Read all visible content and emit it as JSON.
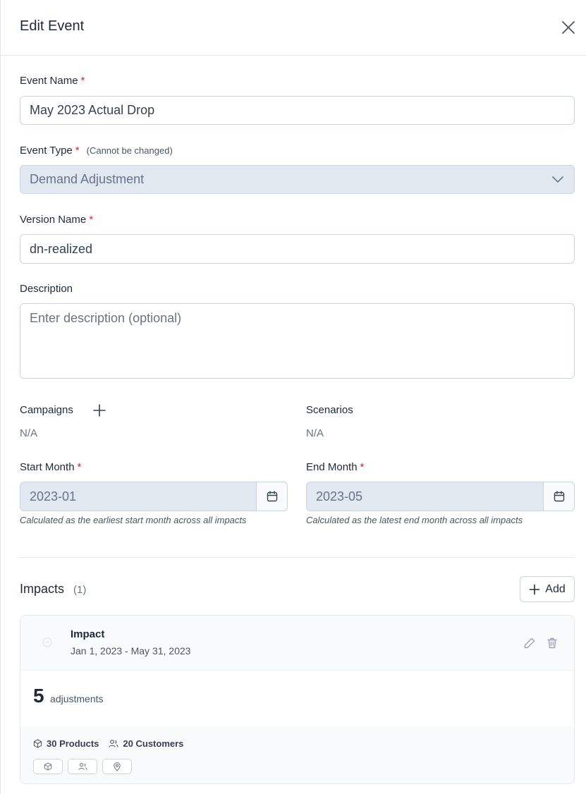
{
  "header": {
    "title": "Edit Event",
    "close_icon": "close-icon"
  },
  "form": {
    "event_name": {
      "label": "Event Name",
      "required_mark": "*",
      "value": "May 2023 Actual Drop"
    },
    "event_type": {
      "label": "Event Type",
      "required_mark": "*",
      "hint": "(Cannot be changed)",
      "value": "Demand Adjustment"
    },
    "version_name": {
      "label": "Version Name",
      "required_mark": "*",
      "value": "dn-realized"
    },
    "description": {
      "label": "Description",
      "placeholder": "Enter description (optional)"
    },
    "campaigns": {
      "label": "Campaigns",
      "value": "N/A"
    },
    "scenarios": {
      "label": "Scenarios",
      "value": "N/A"
    },
    "start_month": {
      "label": "Start Month",
      "required_mark": "*",
      "value": "2023-01",
      "caption": "Calculated as the earliest start month across all impacts"
    },
    "end_month": {
      "label": "End Month",
      "required_mark": "*",
      "value": "2023-05",
      "caption": "Calculated as the latest end month across all impacts"
    }
  },
  "impacts": {
    "title": "Impacts",
    "count": "(1)",
    "add_label": "Add",
    "items": [
      {
        "title": "Impact",
        "date_range": "Jan 1, 2023 - May 31, 2023",
        "adjustments_count": "5",
        "adjustments_label": "adjustments",
        "products": "30 Products",
        "customers": "20 Customers"
      }
    ]
  },
  "colors": {
    "required": "#dc2626",
    "border": "#cbd5e1",
    "disabled_bg": "#e2e8f0",
    "card_bg": "#f8fafc"
  }
}
